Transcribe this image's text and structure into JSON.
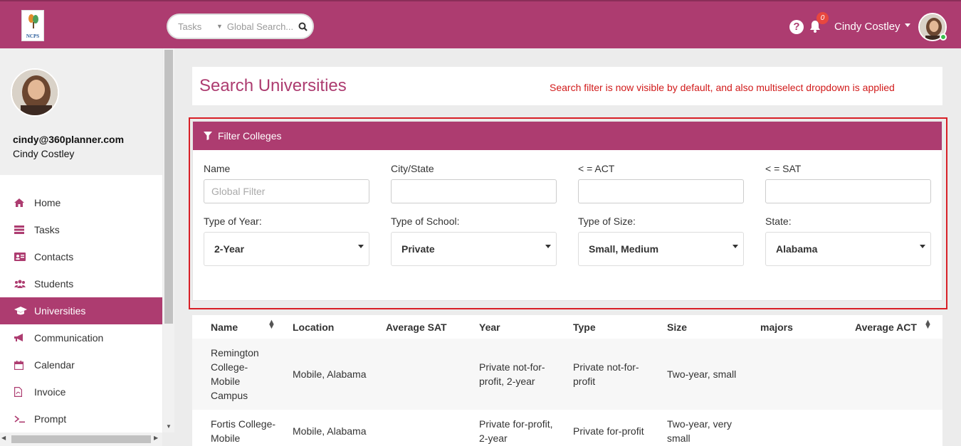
{
  "header": {
    "logo_text": "NCPS",
    "search_scope": "Tasks",
    "search_placeholder": "Global Search...",
    "notification_count": "0",
    "user_name": "Cindy Costley"
  },
  "sidebar": {
    "email": "cindy@360planner.com",
    "name": "Cindy Costley",
    "items": [
      {
        "label": "Home",
        "icon": "home-icon"
      },
      {
        "label": "Tasks",
        "icon": "tasks-icon"
      },
      {
        "label": "Contacts",
        "icon": "contacts-icon"
      },
      {
        "label": "Students",
        "icon": "students-icon"
      },
      {
        "label": "Universities",
        "icon": "graduation-cap-icon"
      },
      {
        "label": "Communication",
        "icon": "megaphone-icon"
      },
      {
        "label": "Calendar",
        "icon": "calendar-icon"
      },
      {
        "label": "Invoice",
        "icon": "pdf-file-icon"
      },
      {
        "label": "Prompt",
        "icon": "terminal-icon"
      }
    ],
    "active_index": 4
  },
  "page": {
    "title": "Search Universities",
    "annotation": "Search filter is now visible by default, and also multiselect dropdown is applied"
  },
  "filter": {
    "heading": "Filter Colleges",
    "name_label": "Name",
    "name_placeholder": "Global Filter",
    "city_label": "City/State",
    "act_label": "< = ACT",
    "sat_label": "< = SAT",
    "year_label": "Type of Year:",
    "year_value": "2-Year",
    "school_label": "Type of School:",
    "school_value": "Private",
    "size_label": "Type of Size:",
    "size_value": "Small, Medium",
    "state_label": "State:",
    "state_value": "Alabama"
  },
  "table": {
    "columns": [
      "Name",
      "Location",
      "Average SAT",
      "Year",
      "Type",
      "Size",
      "majors",
      "Average ACT"
    ],
    "rows": [
      {
        "name": [
          "Remington",
          "College-",
          "Mobile",
          "Campus"
        ],
        "location": "Mobile, Alabama",
        "sat": "",
        "year": [
          "Private not-for-",
          "profit, 2-year"
        ],
        "type": [
          "Private not-for-",
          "profit"
        ],
        "size": [
          "Two-year, small"
        ],
        "majors": "",
        "act": ""
      },
      {
        "name": [
          "Fortis College-",
          "Mobile"
        ],
        "location": "Mobile, Alabama",
        "sat": "",
        "year": [
          "Private for-profit,",
          "2-year"
        ],
        "type": [
          "Private for-profit"
        ],
        "size": [
          "Two-year, very",
          "small"
        ],
        "majors": "",
        "act": ""
      }
    ]
  },
  "colors": {
    "brand": "#ad3c70",
    "annotation_red": "#d81f26"
  }
}
